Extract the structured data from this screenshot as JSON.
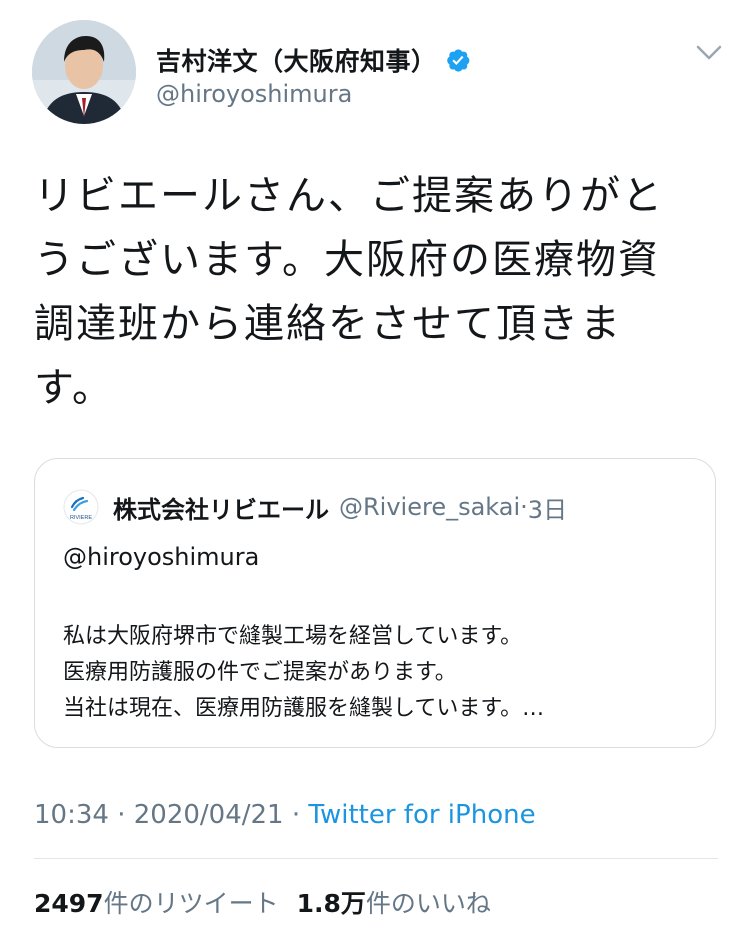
{
  "author": {
    "display_name": "吉村洋文（大阪府知事）",
    "handle": "@hiroyoshimura",
    "verified": true
  },
  "tweet": {
    "lines": [
      "リビエールさん、ご提案ありがと",
      "うございます。大阪府の医療物資",
      "調達班から連絡をさせて頂きま",
      "す。"
    ]
  },
  "quoted_tweet": {
    "logo_text": "RIVIERE",
    "display_name": "株式会社リビエール",
    "handle": "@Riviere_sakai",
    "sep": "·",
    "time": "3日",
    "reply_to": "@hiroyoshimura",
    "body_lines": [
      "私は大阪府堺市で縫製工場を経営しています。",
      "医療用防護服の件でご提案があります。",
      "当社は現在、医療用防護服を縫製しています。…"
    ]
  },
  "meta": {
    "time": "10:34",
    "sep": " · ",
    "date": "2020/04/21",
    "sep2": " · ",
    "source": "Twitter for iPhone"
  },
  "stats": {
    "retweets_count": "2497",
    "retweets_label": "件のリツイート",
    "likes_count": "1.8万",
    "likes_label": "件のいいね"
  },
  "colors": {
    "accent": "#1b95e0",
    "secondary_text": "#657786",
    "verified_badge": "#1da1f2"
  },
  "icons": {
    "verified": "verified-badge-icon",
    "menu": "chevron-down-icon"
  }
}
